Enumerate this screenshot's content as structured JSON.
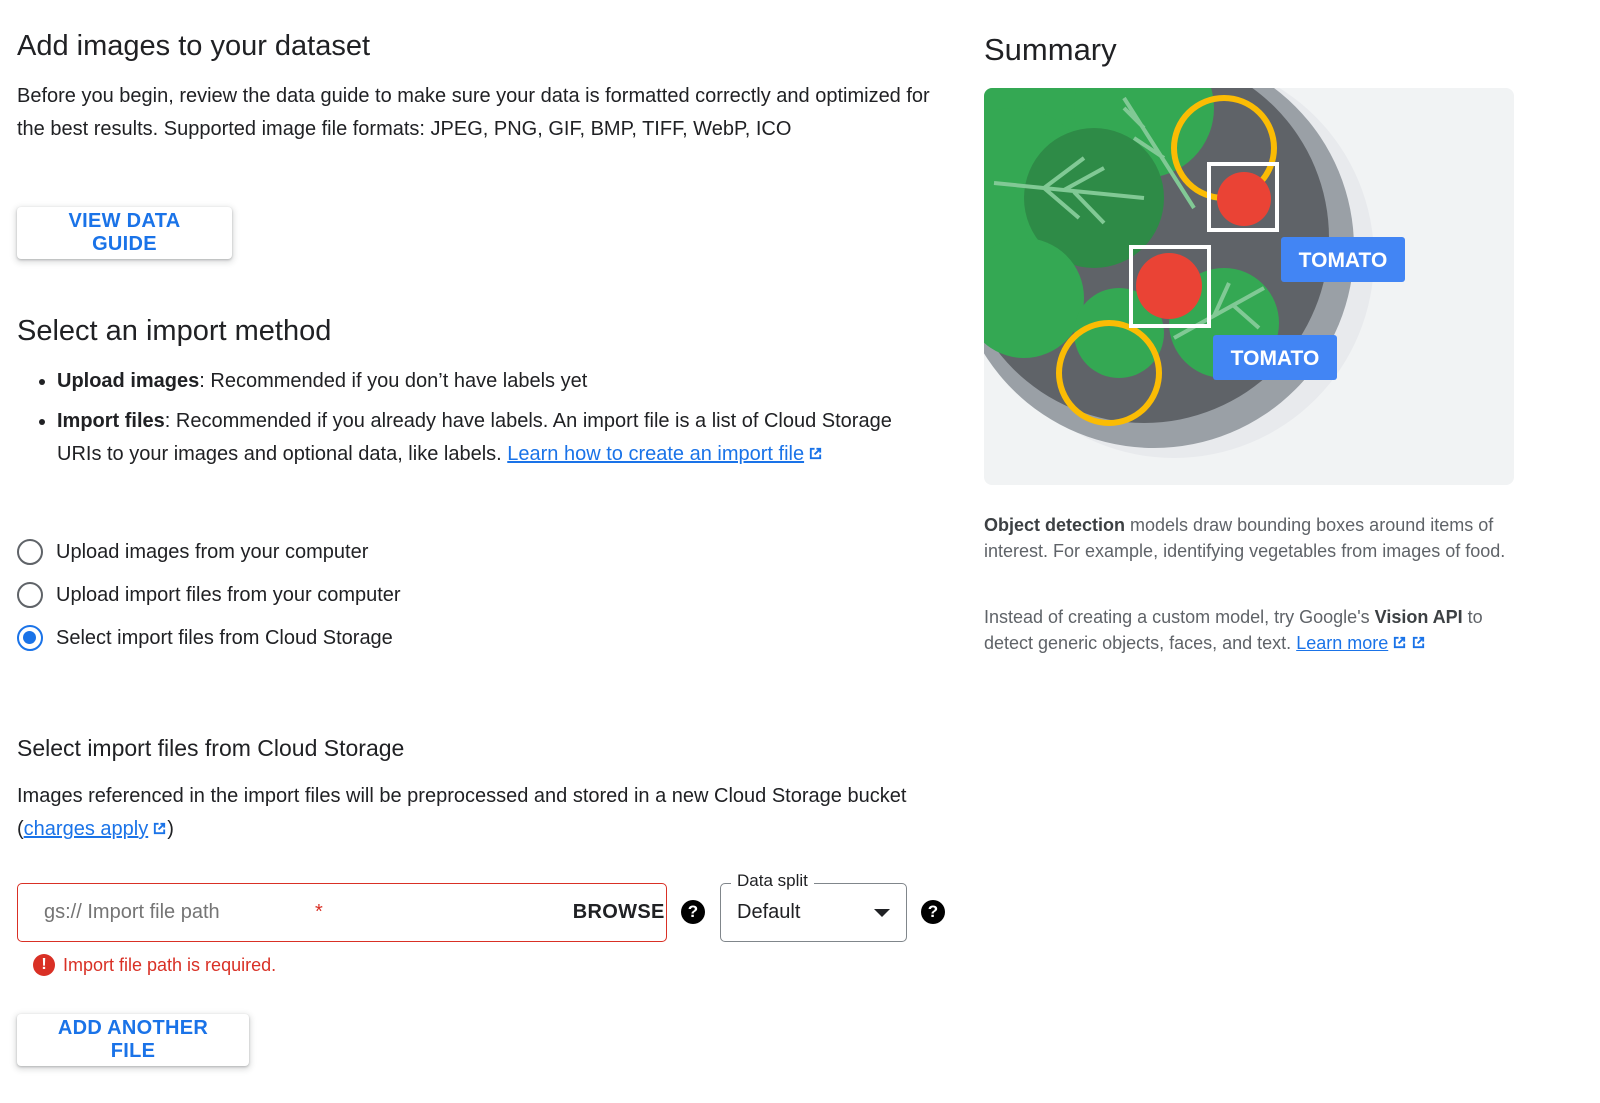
{
  "left": {
    "title": "Add images to your dataset",
    "intro": "Before you begin, review the data guide to make sure your data is formatted correctly and optimized for the best results. Supported image file formats: JPEG, PNG, GIF, BMP, TIFF, WebP, ICO",
    "view_guide_label": "VIEW DATA GUIDE",
    "import_heading": "Select an import method",
    "methods": [
      {
        "bold": "Upload images",
        "text": ": Recommended if you don’t have labels yet"
      },
      {
        "bold": "Import files",
        "text": ": Recommended if you already have labels. An import file is a list of Cloud Storage URIs to your images and optional data, like labels. ",
        "link": "Learn how to create an import file"
      }
    ],
    "radios": [
      {
        "label": "Upload images from your computer",
        "selected": false
      },
      {
        "label": "Upload import files from your computer",
        "selected": false
      },
      {
        "label": "Select import files from Cloud Storage",
        "selected": true
      }
    ],
    "cloud_heading": "Select import files from Cloud Storage",
    "cloud_desc_pre": "Images referenced in the import files will be preprocessed and stored in a new Cloud Storage bucket (",
    "cloud_desc_link": "charges apply",
    "cloud_desc_post": ")",
    "path_placeholder": "gs:// Import file path",
    "required_mark": "*",
    "browse_label": "BROWSE",
    "split_label": "Data split",
    "split_value": "Default",
    "error_text": "Import file path is required.",
    "add_file_label": "ADD ANOTHER FILE",
    "help_glyph": "?",
    "error_glyph": "!"
  },
  "right": {
    "title": "Summary",
    "tag_1": "TOMATO",
    "tag_2": "TOMATO",
    "desc1_bold": "Object detection",
    "desc1_rest": " models draw bounding boxes around items of interest. For example, identifying vegetables from images of food.",
    "desc2_pre": "Instead of creating a custom model, try Google's ",
    "desc2_bold": "Vision API",
    "desc2_mid": " to detect generic objects, faces, and text. ",
    "desc2_link": "Learn more"
  },
  "colors": {
    "accent": "#1a73e8",
    "error": "#d93025",
    "tag": "#4285f4",
    "leaf": "#34a853",
    "tomato": "#ea4335",
    "ring": "#fbbc04"
  }
}
